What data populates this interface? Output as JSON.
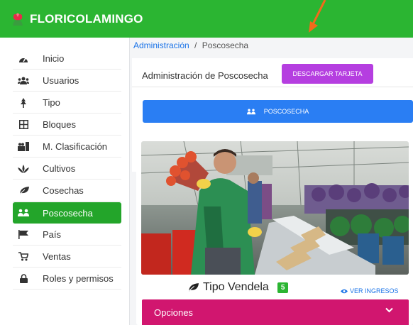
{
  "app": {
    "brand": "FLORICOLAMINGO"
  },
  "sidebar": {
    "items": [
      {
        "label": "Inicio",
        "icon": "dashboard-icon"
      },
      {
        "label": "Usuarios",
        "icon": "users-icon"
      },
      {
        "label": "Tipo",
        "icon": "plant-icon"
      },
      {
        "label": "Bloques",
        "icon": "grid-icon"
      },
      {
        "label": "M. Clasificación",
        "icon": "classification-icon"
      },
      {
        "label": "Cultivos",
        "icon": "cultivo-icon"
      },
      {
        "label": "Cosechas",
        "icon": "leaf-icon"
      },
      {
        "label": "Poscosecha",
        "icon": "group-icon",
        "active": true
      },
      {
        "label": "País",
        "icon": "flag-icon"
      },
      {
        "label": "Ventas",
        "icon": "cart-icon"
      },
      {
        "label": "Roles y permisos",
        "icon": "lock-icon"
      }
    ]
  },
  "breadcrumb": {
    "parent": "Administración",
    "separator": "/",
    "current": "Poscosecha"
  },
  "header": {
    "title": "Administración de Poscosecha",
    "download_label": "DESCARGAR TARJETA"
  },
  "poscosecha_button": {
    "label": "POSCOSECHA"
  },
  "card": {
    "title": "Tipo Vendela",
    "count": "5",
    "ver_ingresos_label": "VER INGRESOS",
    "options_label": "Opciones"
  },
  "colors": {
    "topbar": "#2bb532",
    "active_nav": "#23a52a",
    "download_button": "#b53ee0",
    "poscosecha_button": "#2a7ef3",
    "options_bar": "#d1166f",
    "link": "#1a73e8"
  }
}
